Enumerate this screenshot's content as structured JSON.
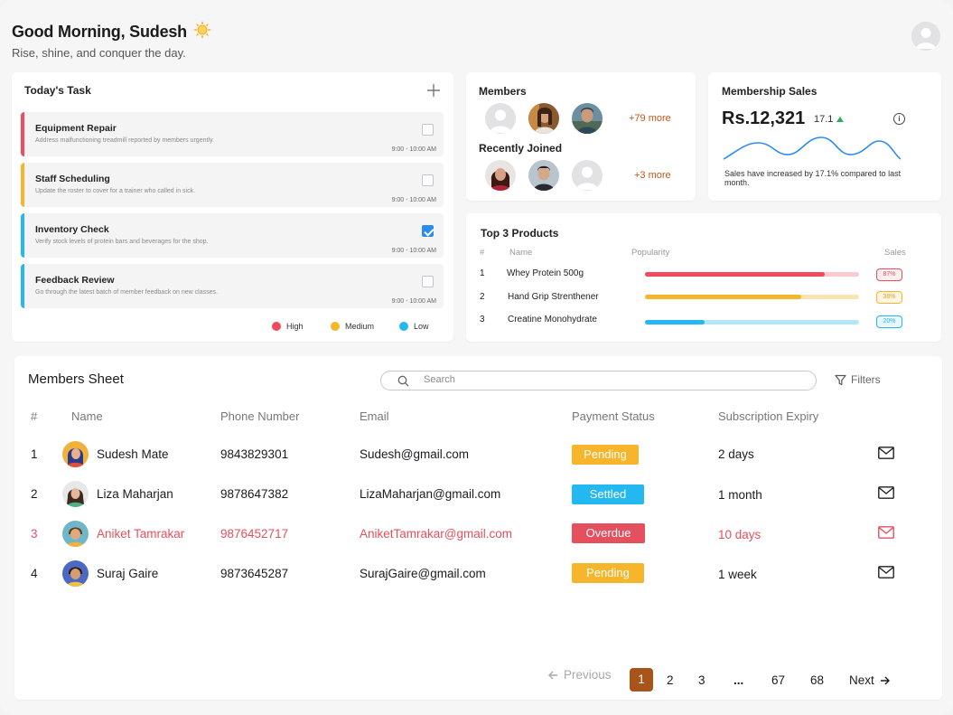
{
  "header": {
    "greeting": "Good Morning, Sudesh",
    "subtitle": "Rise, shine, and conquer the day.",
    "sun_icon": "sun-icon",
    "avatar_icon": "user-avatar-icon"
  },
  "tasks": {
    "title": "Today's Task",
    "add_icon": "plus-icon",
    "items": [
      {
        "title": "Equipment Repair",
        "desc": "Address malfunctioning treadmill reported by members urgently.",
        "time": "9:00 - 10:00 AM",
        "priority": "High",
        "checked": false
      },
      {
        "title": "Staff Scheduling",
        "desc": "Update the roster to cover for a trainer who called in sick.",
        "time": "9:00 - 10:00 AM",
        "priority": "Medium",
        "checked": false
      },
      {
        "title": "Inventory Check",
        "desc": "Verify stock levels of protein bars and beverages for the shop.",
        "time": "9:00 - 10:00 AM",
        "priority": "Low",
        "checked": true
      },
      {
        "title": "Feedback Review",
        "desc": "Go through the latest batch of member feedback on new classes.",
        "time": "9:00 - 10:00 AM",
        "priority": "Low",
        "checked": false
      }
    ],
    "legend": [
      {
        "label": "High",
        "color": "#ef4b5c"
      },
      {
        "label": "Medium",
        "color": "#f7b52c"
      },
      {
        "label": "Low",
        "color": "#24b8f0"
      }
    ]
  },
  "members": {
    "title": "Members",
    "more": "+79 more",
    "recent_title": "Recently Joined",
    "recent_more": "+3 more"
  },
  "sales": {
    "title": "Membership Sales",
    "value": "Rs.12,321",
    "change": "17.1",
    "note": "Sales have increased by 17.1% compared to last month.",
    "trend_icon": "trend-up-icon",
    "info_icon": "info-icon",
    "line_color": "#2a8cf0"
  },
  "products": {
    "title": "Top 3 Products",
    "headers": {
      "num": "#",
      "name": "Name",
      "popularity": "Popularity",
      "sales": "Sales"
    },
    "items": [
      {
        "num": "1",
        "name": "Whey Protein 500g",
        "popularity": 0.84,
        "sales": "87%",
        "color": "#ef4b5c",
        "track": "#fbc9cf"
      },
      {
        "num": "2",
        "name": "Hand Grip Strenthener",
        "popularity": 0.73,
        "sales": "38%",
        "color": "#f7b52c",
        "track": "#fde3b0"
      },
      {
        "num": "3",
        "name": "Creatine Monohydrate",
        "popularity": 0.28,
        "sales": "20%",
        "color": "#24b8f0",
        "track": "#b4e6fa"
      }
    ]
  },
  "sheet": {
    "title": "Members Sheet",
    "search_placeholder": "Search",
    "filters": "Filters",
    "headers": {
      "num": "#",
      "name": "Name",
      "phone": "Phone Number",
      "email": "Email",
      "payment": "Payment Status",
      "expiry": "Subscription Expiry"
    },
    "rows": [
      {
        "num": "1",
        "name": "Sudesh Mate",
        "phone": "9843829301",
        "email": "Sudesh@gmail.com",
        "status": "Pending",
        "status_color": "#f7b52c",
        "expiry": "2 days",
        "overdue": false
      },
      {
        "num": "2",
        "name": "Liza Maharjan",
        "phone": "9878647382",
        "email": "LizaMaharjan@gmail.com",
        "status": "Settled",
        "status_color": "#24b8f0",
        "expiry": "1 month",
        "overdue": false
      },
      {
        "num": "3",
        "name": "Aniket Tamrakar",
        "phone": "9876452717",
        "email": "AniketTamrakar@gmail.com",
        "status": "Overdue",
        "status_color": "#e5505f",
        "expiry": "10 days",
        "overdue": true
      },
      {
        "num": "4",
        "name": "Suraj Gaire",
        "phone": "9873645287",
        "email": "SurajGaire@gmail.com",
        "status": "Pending",
        "status_color": "#f7b52c",
        "expiry": "1 week",
        "overdue": false
      }
    ],
    "pagination": {
      "previous": "Previous",
      "pages": [
        "1",
        "2",
        "3",
        "...",
        "67",
        "68"
      ],
      "current": "1",
      "next": "Next"
    }
  }
}
